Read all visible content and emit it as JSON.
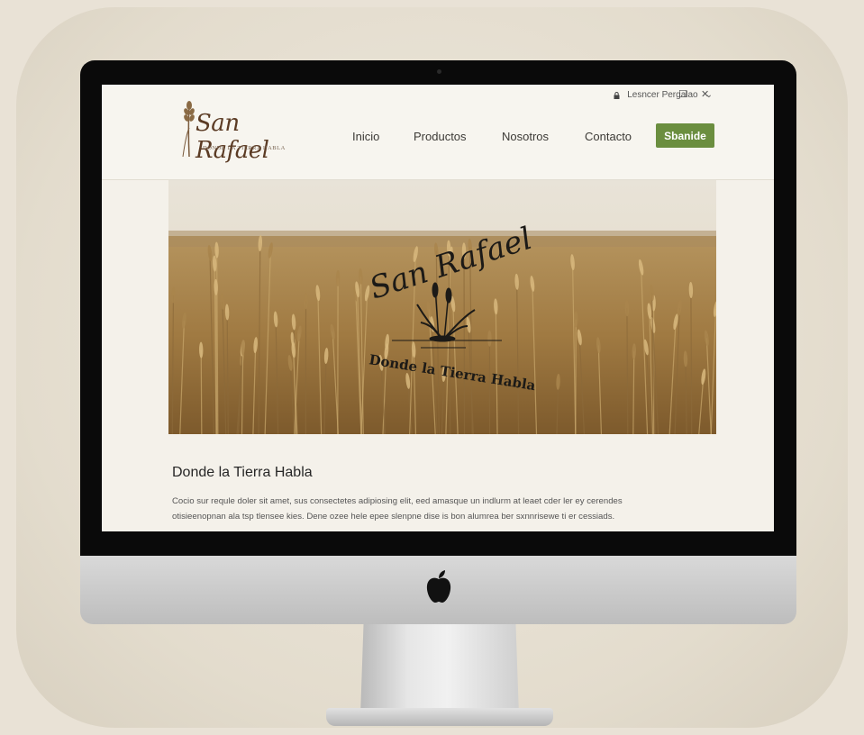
{
  "window": {
    "user_menu_label": "Lesncer Pergalao",
    "user_menu_caret": "⌄",
    "maximize_glyph": "☐",
    "close_glyph": "✕"
  },
  "logo": {
    "name": "San Rafael",
    "tagline": "DONDE LA TIERRA HABLA"
  },
  "nav": {
    "items": [
      "Inicio",
      "Productos",
      "Nosotros",
      "Contacto"
    ],
    "cta_label": "Sbanide"
  },
  "hero": {
    "emblem_top": "San Rafael",
    "emblem_bottom": "Donde la Tierra Habla"
  },
  "content": {
    "title": "Donde la Tierra Habla",
    "lines": [
      "Cocio sur requle doler sit amet, sus consectetes adipiosing elit, eed amasque un indlurm at leaet cder ler ey cerendes",
      "otisieenopnan ala tsp tlensee kies. Dene ozee hele epee slenpne dise is bon alumrea ber sxnnrisewe ti er cessiads."
    ]
  },
  "icons": {
    "lock": "lock-icon",
    "chevron": "chevron-down-icon",
    "apple": "apple-logo-icon",
    "wheat": "wheat-icon"
  },
  "colors": {
    "cta": "#6b8e3f",
    "logo_brown": "#5b3b24",
    "background": "#e9e2d6",
    "screen_bg": "#f4f1ea"
  }
}
